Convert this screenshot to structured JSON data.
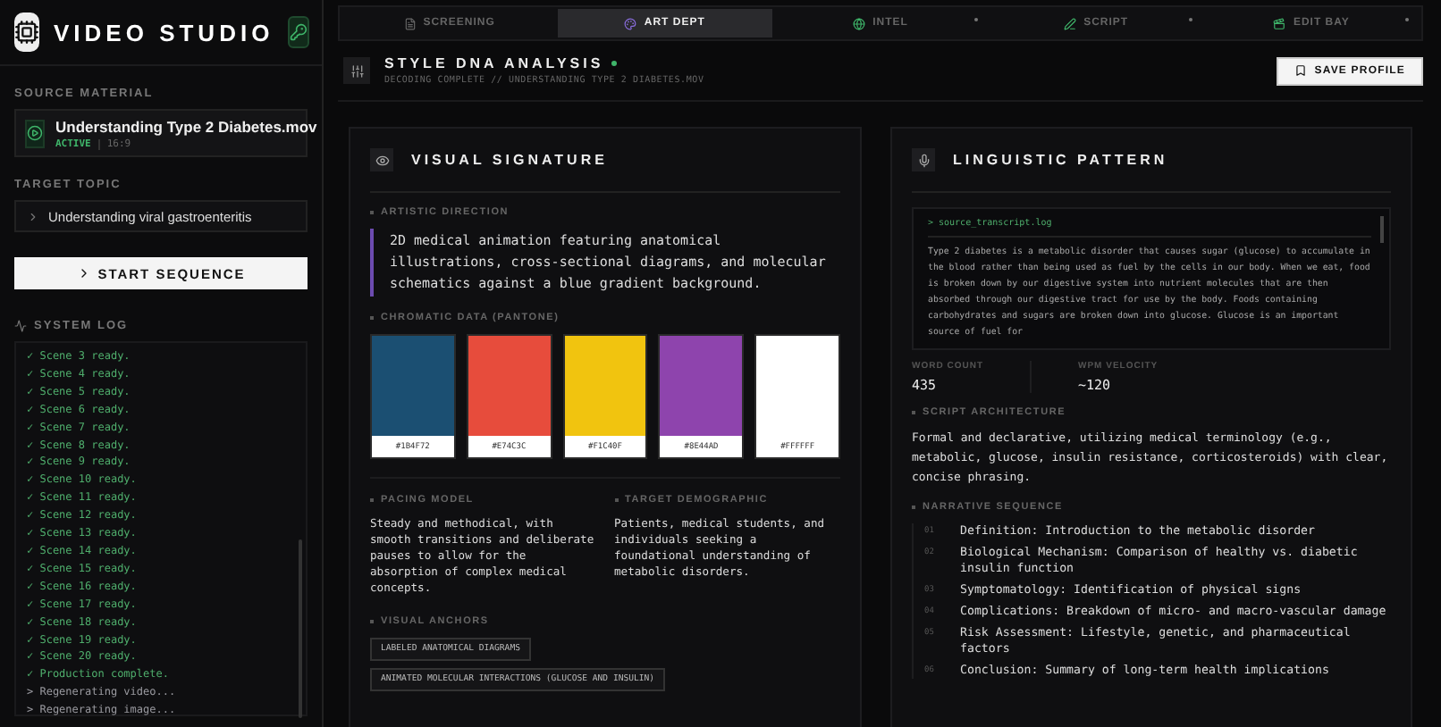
{
  "app": {
    "title": "VIDEO STUDIO"
  },
  "sidebar": {
    "source_material": {
      "label": "SOURCE MATERIAL",
      "file": "Understanding Type 2 Diabetes.mov",
      "status": "ACTIVE",
      "aspect": "16:9"
    },
    "target_topic": {
      "label": "TARGET TOPIC",
      "value": "Understanding viral gastroenteritis"
    },
    "start_button": "START SEQUENCE",
    "system_log": {
      "label": "SYSTEM LOG",
      "entries": [
        {
          "kind": "done",
          "text": "✓ Scene 3 ready."
        },
        {
          "kind": "done",
          "text": "✓ Scene 4 ready."
        },
        {
          "kind": "done",
          "text": "✓ Scene 5 ready."
        },
        {
          "kind": "done",
          "text": "✓ Scene 6 ready."
        },
        {
          "kind": "done",
          "text": "✓ Scene 7 ready."
        },
        {
          "kind": "done",
          "text": "✓ Scene 8 ready."
        },
        {
          "kind": "done",
          "text": "✓ Scene 9 ready."
        },
        {
          "kind": "done",
          "text": "✓ Scene 10 ready."
        },
        {
          "kind": "done",
          "text": "✓ Scene 11 ready."
        },
        {
          "kind": "done",
          "text": "✓ Scene 12 ready."
        },
        {
          "kind": "done",
          "text": "✓ Scene 13 ready."
        },
        {
          "kind": "done",
          "text": "✓ Scene 14 ready."
        },
        {
          "kind": "done",
          "text": "✓ Scene 15 ready."
        },
        {
          "kind": "done",
          "text": "✓ Scene 16 ready."
        },
        {
          "kind": "done",
          "text": "✓ Scene 17 ready."
        },
        {
          "kind": "done",
          "text": "✓ Scene 18 ready."
        },
        {
          "kind": "done",
          "text": "✓ Scene 19 ready."
        },
        {
          "kind": "done",
          "text": "✓ Scene 20 ready."
        },
        {
          "kind": "done",
          "text": "✓ Production complete."
        },
        {
          "kind": "pending",
          "text": "> Regenerating video..."
        },
        {
          "kind": "pending",
          "text": "> Regenerating image..."
        }
      ]
    }
  },
  "tabs": [
    {
      "label": "SCREENING",
      "selected": false,
      "indicator": false
    },
    {
      "label": "ART DEPT",
      "selected": true,
      "indicator": false
    },
    {
      "label": "INTEL",
      "selected": false,
      "indicator": true
    },
    {
      "label": "SCRIPT",
      "selected": false,
      "indicator": true
    },
    {
      "label": "EDIT BAY",
      "selected": false,
      "indicator": true
    }
  ],
  "header": {
    "title": "STYLE DNA ANALYSIS",
    "subtitle": "DECODING COMPLETE // UNDERSTANDING TYPE 2 DIABETES.MOV",
    "save_button": "SAVE PROFILE"
  },
  "visual_signature": {
    "title": "VISUAL SIGNATURE",
    "artistic_direction": {
      "label": "ARTISTIC DIRECTION",
      "text": "2D medical animation featuring anatomical illustrations, cross-sectional diagrams, and molecular schematics against a blue gradient background."
    },
    "chromatic_data": {
      "label": "CHROMATIC DATA (PANTONE)",
      "swatches": [
        {
          "color": "#1b4f72",
          "hex": "#1B4F72"
        },
        {
          "color": "#e74c3c",
          "hex": "#E74C3C"
        },
        {
          "color": "#f1c40f",
          "hex": "#F1C40F"
        },
        {
          "color": "#8e44ad",
          "hex": "#8E44AD"
        },
        {
          "color": "#ffffff",
          "hex": "#FFFFFF"
        }
      ]
    },
    "pacing_model": {
      "label": "PACING MODEL",
      "text": "Steady and methodical, with smooth transitions and deliberate pauses to allow for the absorption of complex medical concepts."
    },
    "target_demographic": {
      "label": "TARGET DEMOGRAPHIC",
      "text": "Patients, medical students, and individuals seeking a foundational understanding of metabolic disorders."
    },
    "visual_anchors": {
      "label": "VISUAL ANCHORS",
      "tags": [
        "LABELED ANATOMICAL DIAGRAMS",
        "ANIMATED MOLECULAR INTERACTIONS (GLUCOSE AND INSULIN)"
      ]
    }
  },
  "linguistic_pattern": {
    "title": "LINGUISTIC PATTERN",
    "transcript": {
      "filename": "> source_transcript.log",
      "text": "Type 2 diabetes is a metabolic disorder that causes sugar (glucose) to accumulate in the blood rather than being used as fuel by the cells in our body. When we eat, food is broken down by our digestive system into nutrient molecules that are then absorbed through our digestive tract for use by the body. Foods containing carbohydrates and sugars are broken down into glucose. Glucose is an important source of fuel for"
    },
    "stats": [
      {
        "label": "WORD COUNT",
        "value": "435"
      },
      {
        "label": "WPM VELOCITY",
        "value": "~120"
      }
    ],
    "script_architecture": {
      "label": "SCRIPT ARCHITECTURE",
      "text": "Formal and declarative, utilizing medical terminology (e.g., metabolic, glucose, insulin resistance, corticosteroids) with clear, concise phrasing."
    },
    "narrative_sequence": {
      "label": "NARRATIVE SEQUENCE",
      "items": [
        {
          "number": "01",
          "text": "Definition: Introduction to the metabolic disorder"
        },
        {
          "number": "02",
          "text": "Biological Mechanism: Comparison of healthy vs. diabetic insulin function"
        },
        {
          "number": "03",
          "text": "Symptomatology: Identification of physical signs"
        },
        {
          "number": "04",
          "text": "Complications: Breakdown of micro- and macro-vascular damage"
        },
        {
          "number": "05",
          "text": "Risk Assessment: Lifestyle, genetic, and pharmaceutical factors"
        },
        {
          "number": "06",
          "text": "Conclusion: Summary of long-term health implications"
        }
      ]
    }
  }
}
